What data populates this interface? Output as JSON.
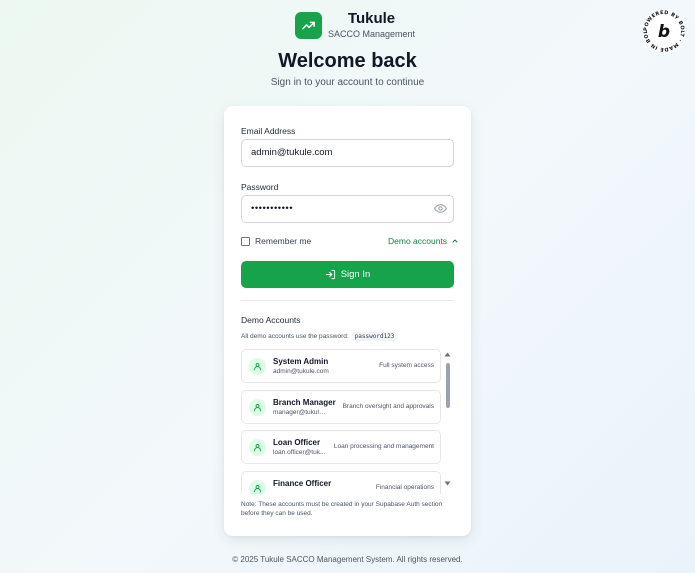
{
  "brand": {
    "name": "Tukule",
    "subtitle": "SACCO Management"
  },
  "header": {
    "title": "Welcome back",
    "subtitle": "Sign in to your account to continue"
  },
  "badge": {
    "text": "POWERED BY BOLT · MADE IN BOLT ·",
    "letter": "b"
  },
  "form": {
    "email_label": "Email Address",
    "email_value": "admin@tukule.com",
    "password_label": "Password",
    "password_value": "•••••••••••",
    "remember_label": "Remember me",
    "demo_toggle_label": "Demo accounts",
    "signin_label": "Sign In"
  },
  "demo": {
    "title": "Demo Accounts",
    "note": "All demo accounts use the password:",
    "password": "password123",
    "accounts": [
      {
        "name": "System Admin",
        "email": "admin@tukule.com",
        "description": "Full system access"
      },
      {
        "name": "Branch Manager",
        "email": "manager@tukule.c...",
        "description": "Branch oversight and approvals"
      },
      {
        "name": "Loan Officer",
        "email": "loan.officer@tuk...",
        "description": "Loan processing and management"
      },
      {
        "name": "Finance Officer",
        "email": "",
        "description": "Financial operations"
      }
    ],
    "footnote": "Note: These accounts must be created in your Supabase Auth section before they can be used."
  },
  "footer": {
    "text": "© 2025 Tukule SACCO Management System. All rights reserved."
  },
  "colors": {
    "accent": "#16a34a",
    "accent_text": "#15803d",
    "avatar_bg": "#dcfce7"
  },
  "icons": {
    "brand": "trending-up-icon",
    "password": "eye-icon",
    "toggle": "chevron-up-icon",
    "signin": "log-in-icon",
    "account": "user-icon"
  }
}
